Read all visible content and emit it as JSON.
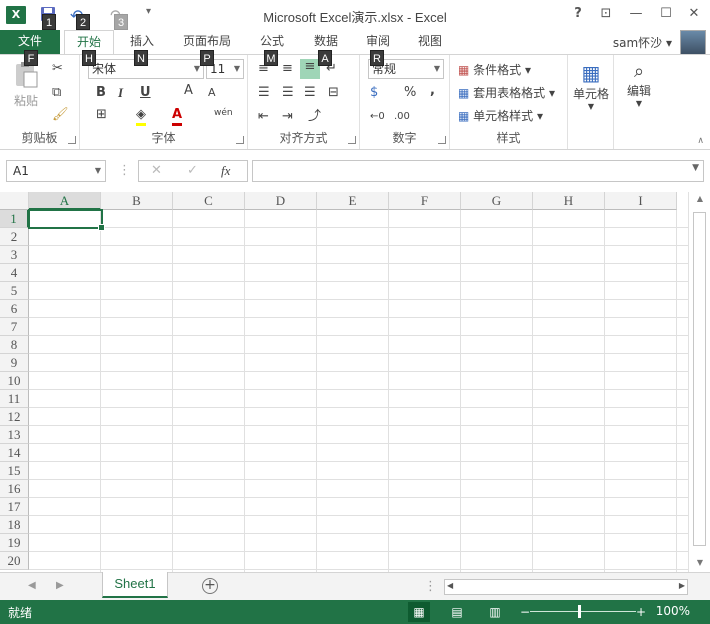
{
  "window": {
    "title": "Microsoft Excel演示.xlsx - Excel",
    "help": "?",
    "restore_ribbon": "⊡",
    "minimize": "—",
    "maximize": "☐",
    "close": "✕"
  },
  "qat": {
    "logo": "X",
    "save_keytip": "1",
    "undo_keytip": "2",
    "redo_keytip": "3",
    "customize": "▾"
  },
  "tabs": [
    {
      "label": "文件",
      "keytip": "F"
    },
    {
      "label": "开始",
      "keytip": "H"
    },
    {
      "label": "插入",
      "keytip": "N"
    },
    {
      "label": "页面布局",
      "keytip": "P"
    },
    {
      "label": "公式",
      "keytip": "M"
    },
    {
      "label": "数据",
      "keytip": "A"
    },
    {
      "label": "审阅",
      "keytip": "R"
    },
    {
      "label": "视图",
      "keytip": ""
    }
  ],
  "user": {
    "name": "sam怀沙"
  },
  "ribbon": {
    "clipboard": {
      "label": "剪贴板",
      "paste_label": "粘贴"
    },
    "font": {
      "label": "字体",
      "font_name": "宋体",
      "font_size": "11",
      "bold": "B",
      "italic": "I",
      "underline": "U",
      "grow": "A",
      "shrink": "A",
      "phonetic": "wén"
    },
    "alignment": {
      "label": "对齐方式"
    },
    "number": {
      "label": "数字",
      "format": "常规",
      "percent": "%",
      "comma": ","
    },
    "styles": {
      "label": "样式",
      "conditional": "条件格式",
      "table": "套用表格格式",
      "cell_styles": "单元格样式"
    },
    "cells": {
      "label": "单元格"
    },
    "editing": {
      "label": "编辑"
    }
  },
  "formula_bar": {
    "name_box": "A1",
    "cancel": "✕",
    "enter": "✓",
    "fx": "fx",
    "value": ""
  },
  "sheet": {
    "columns": [
      "A",
      "B",
      "C",
      "D",
      "E",
      "F",
      "G",
      "H",
      "I"
    ],
    "rows": [
      "1",
      "2",
      "3",
      "4",
      "5",
      "6",
      "7",
      "8",
      "9",
      "10",
      "11",
      "12",
      "13",
      "14",
      "15",
      "16",
      "17",
      "18",
      "19",
      "20"
    ],
    "active_cell": "A1"
  },
  "sheet_tabs": [
    {
      "label": "Sheet1"
    }
  ],
  "add_sheet": "+",
  "status": {
    "text": "就绪",
    "zoom": "100%",
    "zoom_minus": "−",
    "zoom_plus": "+"
  }
}
